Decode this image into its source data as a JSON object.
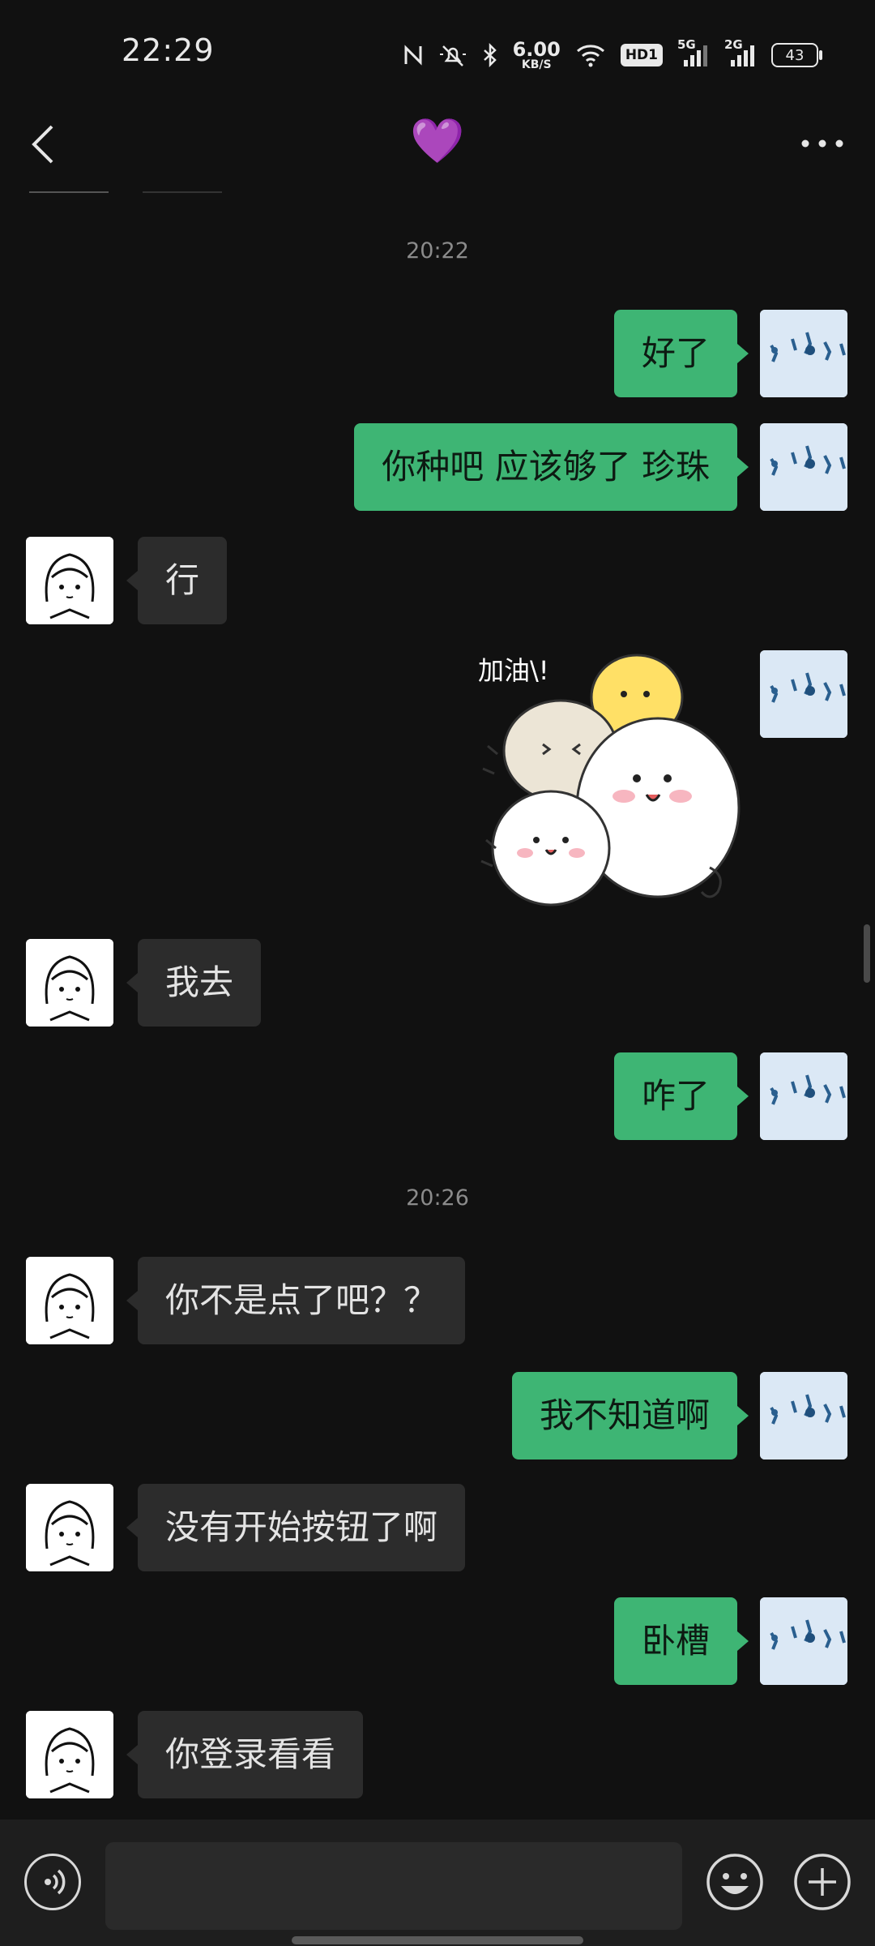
{
  "status_bar": {
    "time": "22:29",
    "net_speed_value": "6.00",
    "net_speed_unit": "KB/S",
    "hd_label": "HD1",
    "signal1_label": "5G",
    "signal2_label": "2G",
    "battery_level": "43",
    "icons": [
      "nfc-icon",
      "mute-icon",
      "bluetooth-icon",
      "wifi-icon",
      "hd-icon",
      "signal-icon",
      "signal-icon",
      "battery-icon"
    ]
  },
  "header": {
    "title": "💜",
    "back_icon": "chevron-left-icon",
    "more_icon": "more-horizontal-icon"
  },
  "chat": {
    "timestamps": [
      "20:22",
      "20:26"
    ],
    "messages": [
      {
        "from": "me",
        "text": "好了"
      },
      {
        "from": "me",
        "text": "你种吧 应该够了 珍珠"
      },
      {
        "from": "them",
        "text": "行"
      },
      {
        "from": "me",
        "type": "sticker",
        "sticker_text": "加油\\!"
      },
      {
        "from": "them",
        "text": "我去"
      },
      {
        "from": "me",
        "text": "咋了"
      },
      {
        "from": "them",
        "text": "你不是点了吧？？"
      },
      {
        "from": "me",
        "text": "我不知道啊"
      },
      {
        "from": "them",
        "text": "没有开始按钮了啊"
      },
      {
        "from": "me",
        "text": "卧槽"
      },
      {
        "from": "them",
        "text": "你登录看看"
      }
    ]
  },
  "input_bar": {
    "voice_icon": "voice-icon",
    "input_value": "",
    "emoji_icon": "emoji-icon",
    "plus_icon": "plus-circle-icon"
  },
  "colors": {
    "background": "#111111",
    "my_bubble": "#3eb574",
    "their_bubble": "#2c2c2c",
    "input_bar": "#1e1e1e"
  }
}
